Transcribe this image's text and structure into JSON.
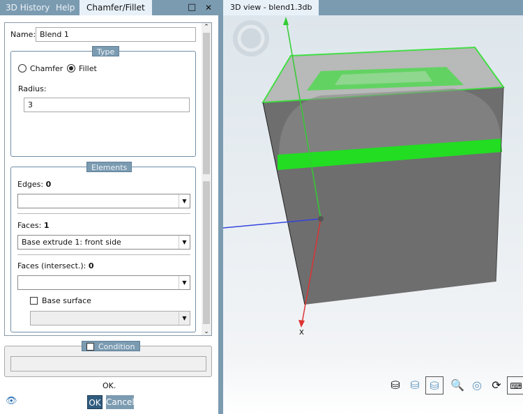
{
  "tabs": [
    {
      "label": "3D History"
    },
    {
      "label": "Help"
    },
    {
      "label": "Chamfer/Fillet"
    }
  ],
  "window_buttons": {
    "maximize": "□",
    "close": "✕"
  },
  "view_tab": "3D view - blend1.3db",
  "form": {
    "name_label": "Name:",
    "name_value": "Blend 1",
    "type_legend": "Type",
    "chamfer_label": "Chamfer",
    "fillet_label": "Fillet",
    "selected_type": "Fillet",
    "radius_label": "Radius:",
    "radius_value": "3",
    "elements_legend": "Elements",
    "edges_label": "Edges:",
    "edges_count": "0",
    "edges_value": "",
    "faces_label": "Faces:",
    "faces_count": "1",
    "faces_value": "Base extrude 1: front side",
    "faces_intersect_label": "Faces (intersect.):",
    "faces_intersect_count": "0",
    "faces_intersect_value": "",
    "base_surface_label": "Base surface",
    "base_surface_checked": false,
    "condition_legend": "Condition",
    "condition_checked": false
  },
  "status": "OK.",
  "buttons": {
    "ok": "OK",
    "cancel": "Cancel"
  },
  "axis_label": "X",
  "colors": {
    "accent": "#7b9bb1",
    "ok_button": "#2f5c7f",
    "highlight": "#22dd22"
  }
}
